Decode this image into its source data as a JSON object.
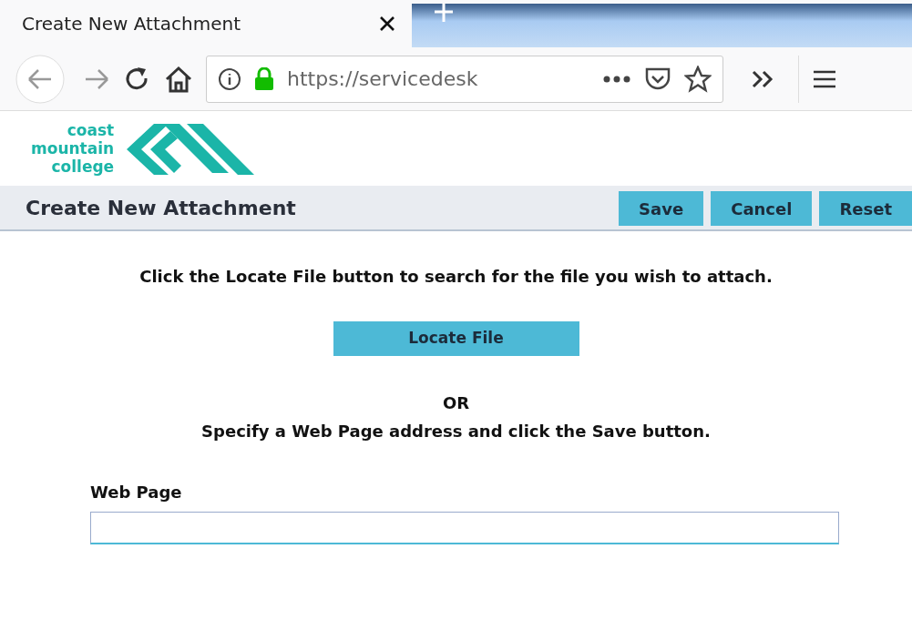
{
  "browser": {
    "tab_title": "Create New Attachment",
    "url": "https://servicedesk"
  },
  "logo": {
    "lines": [
      "coast",
      "mountain",
      "college"
    ]
  },
  "header": {
    "title": "Create New Attachment",
    "buttons": [
      "Save",
      "Cancel",
      "Reset"
    ]
  },
  "content": {
    "instruction": "Click the Locate File button to search for the file you wish to attach.",
    "locate_button": "Locate File",
    "or": "OR",
    "instruction_2": "Specify a Web Page address and click the Save button.",
    "web_page_label": "Web Page"
  }
}
